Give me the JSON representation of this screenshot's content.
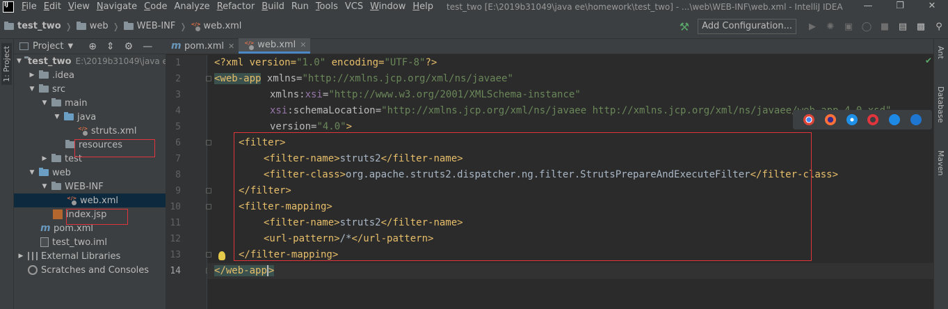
{
  "menubar": {
    "items": [
      {
        "label": "File",
        "u": "F",
        "rest": "ile"
      },
      {
        "label": "Edit",
        "u": "E",
        "rest": "dit"
      },
      {
        "label": "View",
        "u": "V",
        "rest": "iew"
      },
      {
        "label": "Navigate",
        "u": "N",
        "rest": "avigate"
      },
      {
        "label": "Code",
        "u": "C",
        "rest": "ode"
      },
      {
        "label": "Analyze",
        "u": "",
        "rest": "Analyze"
      },
      {
        "label": "Refactor",
        "u": "R",
        "rest": "efactor"
      },
      {
        "label": "Build",
        "u": "B",
        "rest": "uild"
      },
      {
        "label": "Run",
        "u": "",
        "rest": "Run"
      },
      {
        "label": "Tools",
        "u": "T",
        "rest": "ools"
      },
      {
        "label": "VCS",
        "u": "",
        "rest": "VCS"
      },
      {
        "label": "Window",
        "u": "W",
        "rest": "indow"
      },
      {
        "label": "Help",
        "u": "H",
        "rest": "elp"
      }
    ],
    "title": "test_two [E:\\2019b31049\\java ee\\homework\\test_two] - ...\\web\\WEB-INF\\web.xml - IntelliJ IDEA"
  },
  "navbar": {
    "crumbs": [
      "test_two",
      "web",
      "WEB-INF",
      "web.xml"
    ],
    "add_config": "Add Configuration..."
  },
  "left_strip": {
    "label": "1: Project"
  },
  "project_panel": {
    "title": "Project",
    "tree": [
      {
        "label": "test_two",
        "path": "E:\\2019b31049\\java e"
      },
      {
        "label": ".idea"
      },
      {
        "label": "src"
      },
      {
        "label": "main"
      },
      {
        "label": "java"
      },
      {
        "label": "struts.xml"
      },
      {
        "label": "resources"
      },
      {
        "label": "test"
      },
      {
        "label": "web"
      },
      {
        "label": "WEB-INF"
      },
      {
        "label": "web.xml"
      },
      {
        "label": "index.jsp"
      },
      {
        "label": "pom.xml"
      },
      {
        "label": "test_two.iml"
      },
      {
        "label": "External Libraries"
      },
      {
        "label": "Scratches and Consoles"
      }
    ]
  },
  "editor": {
    "tabs": [
      {
        "label": "pom.xml"
      },
      {
        "label": "web.xml"
      }
    ],
    "line_numbers": [
      "1",
      "2",
      "3",
      "4",
      "5",
      "6",
      "7",
      "8",
      "9",
      "10",
      "11",
      "12",
      "13",
      "14"
    ],
    "code": {
      "l1_a": "<?xml version=",
      "l1_b": "\"1.0\"",
      "l1_c": " encoding=",
      "l1_d": "\"UTF-8\"",
      "l1_e": "?>",
      "l2_a": "<web-app",
      "l2_b": " xmlns=",
      "l2_c": "\"http://xmlns.jcp.org/xml/ns/javaee\"",
      "l3_a": "xmlns:",
      "l3_b": "xsi",
      "l3_c": "=",
      "l3_d": "\"http://www.w3.org/2001/XMLSchema-instance\"",
      "l4_a": "xsi",
      "l4_b": ":schemaLocation=",
      "l4_c": "\"http://xmlns.jcp.org/xml/ns/javaee http://xmlns.jcp.org/xml/ns/javaee/web-app_4_0.xsd\"",
      "l5_a": "version=",
      "l5_b": "\"4.0\"",
      "l5_c": ">",
      "l6": "<filter>",
      "l7_a": "<filter-name>",
      "l7_b": "struts2",
      "l7_c": "</filter-name>",
      "l8_a": "<filter-class>",
      "l8_b": "org.apache.struts2.dispatcher.ng.filter.StrutsPrepareAndExecuteFilter",
      "l8_c": "</filter-class>",
      "l9": "</filter>",
      "l10": "<filter-mapping>",
      "l11_a": "<filter-name>",
      "l11_b": "struts2",
      "l11_c": "</filter-name>",
      "l12_a": "<url-pattern>",
      "l12_b": "/*",
      "l12_c": "</url-pattern>",
      "l13": "</filter-mapping>",
      "l14_a": "<",
      "l14_b": "/web-app",
      "l14_c": ">"
    }
  },
  "right_strip": {
    "labels": [
      "Ant",
      "Database",
      "Maven"
    ]
  },
  "colors": {
    "accent": "#4a88c7",
    "highlight_box": "#e0353c",
    "selection": "#0d293e"
  }
}
